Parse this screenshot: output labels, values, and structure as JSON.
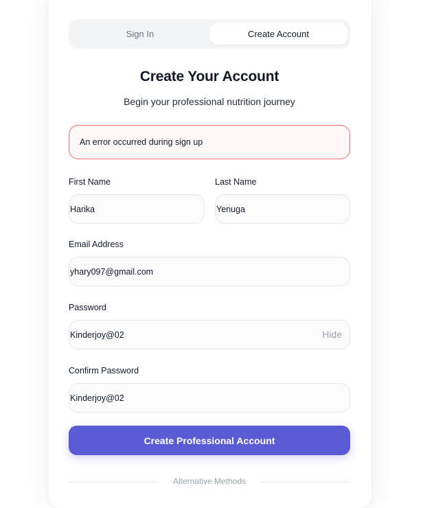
{
  "tabs": {
    "signin_label": "Sign In",
    "create_label": "Create Account",
    "active": "Create Account"
  },
  "header": {
    "title": "Create Your Account",
    "subtitle": "Begin your professional nutrition journey"
  },
  "error": {
    "message": "An error occurred during sign up",
    "color": "#ef6b6b"
  },
  "form": {
    "first_name": {
      "label": "First Name",
      "value": "Harika"
    },
    "last_name": {
      "label": "Last Name",
      "value": "Yenuga"
    },
    "email": {
      "label": "Email Address",
      "value": "yhary097@gmail.com"
    },
    "password": {
      "label": "Password",
      "value": "Kinderjoy@02",
      "toggle_label": "Hide"
    },
    "confirm_password": {
      "label": "Confirm Password",
      "value": "Kinderjoy@02"
    },
    "submit_label": "Create Professional Account"
  },
  "divider": {
    "label": "Alternative Methods"
  },
  "colors": {
    "accent": "#5b5bd6",
    "error_border": "#ef6b6b"
  }
}
